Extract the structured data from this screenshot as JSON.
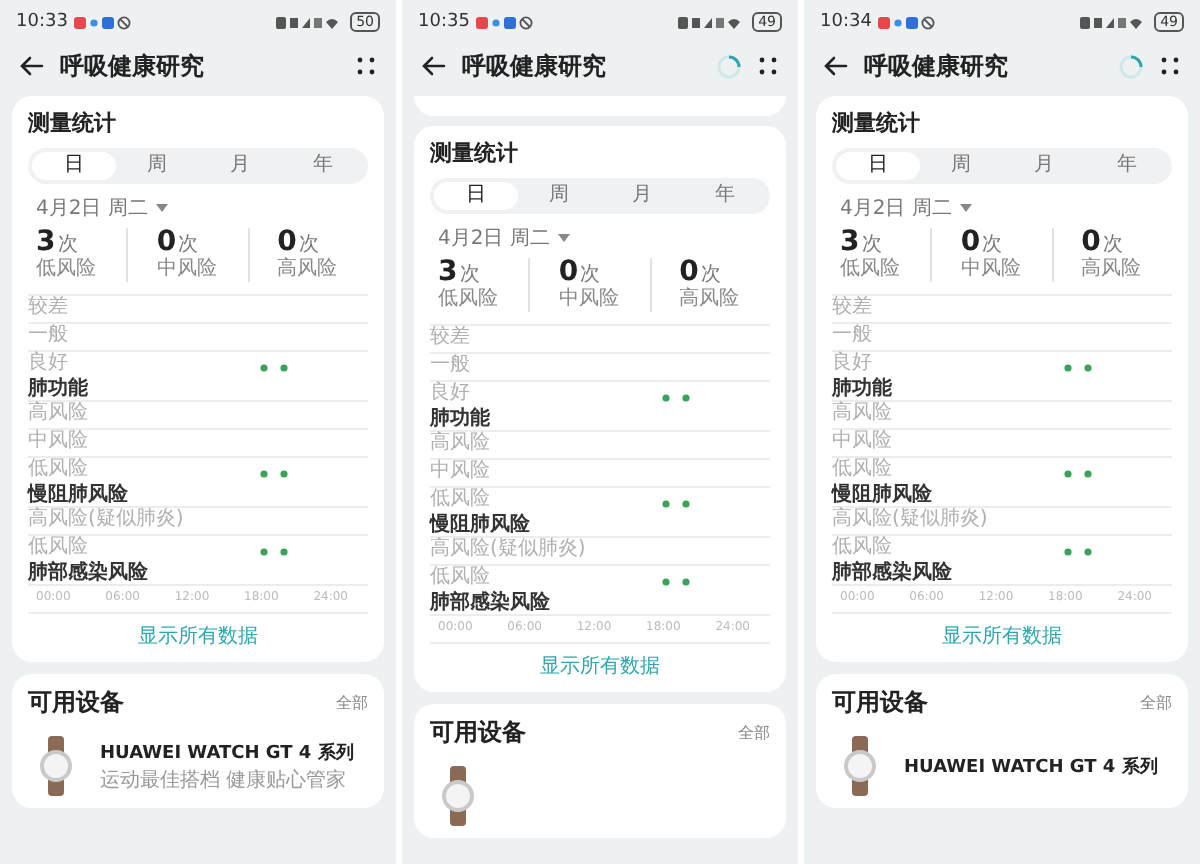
{
  "phones": [
    {
      "time": "10:33",
      "battery": "50",
      "title": "呼吸健康研究",
      "sync_ring": false,
      "previous_card": false,
      "stats_card": {
        "title": "测量统计",
        "tabs": [
          {
            "label": "日",
            "selected": true
          },
          {
            "label": "周",
            "selected": false
          },
          {
            "label": "月",
            "selected": false
          },
          {
            "label": "年",
            "selected": false
          }
        ],
        "date": "4月2日 周二",
        "stats": [
          {
            "value": "3",
            "unit": "次",
            "label": "低风险"
          },
          {
            "value": "0",
            "unit": "次",
            "label": "中风险"
          },
          {
            "value": "0",
            "unit": "次",
            "label": "高风险"
          }
        ],
        "groups": [
          {
            "category": "肺功能",
            "levels": [
              {
                "label": "较差",
                "readings": false
              },
              {
                "label": "一般",
                "readings": false
              },
              {
                "label": "良好",
                "readings": true
              }
            ]
          },
          {
            "category": "慢阻肺风险",
            "levels": [
              {
                "label": "高风险",
                "readings": false
              },
              {
                "label": "中风险",
                "readings": false
              },
              {
                "label": "低风险",
                "readings": true
              }
            ]
          },
          {
            "category": "肺部感染风险",
            "levels": [
              {
                "label": "高风险(疑似肺炎)",
                "readings": false
              },
              {
                "label": "低风险",
                "readings": true
              }
            ]
          }
        ],
        "x_ticks": [
          "00:00",
          "06:00",
          "12:00",
          "18:00",
          "24:00"
        ],
        "show_all": "显示所有数据"
      },
      "devices": {
        "title": "可用设备",
        "all_link": "全部",
        "device": {
          "name": "HUAWEI WATCH GT 4 系列",
          "subtitle": "运动最佳搭档 健康贴心管家"
        }
      }
    },
    {
      "time": "10:35",
      "battery": "49",
      "title": "呼吸健康研究",
      "sync_ring": true,
      "previous_card": true,
      "stats_card": {
        "title": "测量统计",
        "tabs": [
          {
            "label": "日",
            "selected": true
          },
          {
            "label": "周",
            "selected": false
          },
          {
            "label": "月",
            "selected": false
          },
          {
            "label": "年",
            "selected": false
          }
        ],
        "date": "4月2日 周二",
        "stats": [
          {
            "value": "3",
            "unit": "次",
            "label": "低风险"
          },
          {
            "value": "0",
            "unit": "次",
            "label": "中风险"
          },
          {
            "value": "0",
            "unit": "次",
            "label": "高风险"
          }
        ],
        "groups": [
          {
            "category": "肺功能",
            "levels": [
              {
                "label": "较差",
                "readings": false
              },
              {
                "label": "一般",
                "readings": false
              },
              {
                "label": "良好",
                "readings": true
              }
            ]
          },
          {
            "category": "慢阻肺风险",
            "levels": [
              {
                "label": "高风险",
                "readings": false
              },
              {
                "label": "中风险",
                "readings": false
              },
              {
                "label": "低风险",
                "readings": true
              }
            ]
          },
          {
            "category": "肺部感染风险",
            "levels": [
              {
                "label": "高风险(疑似肺炎)",
                "readings": false
              },
              {
                "label": "低风险",
                "readings": true
              }
            ]
          }
        ],
        "x_ticks": [
          "00:00",
          "06:00",
          "12:00",
          "18:00",
          "24:00"
        ],
        "show_all": "显示所有数据"
      },
      "devices": {
        "title": "可用设备",
        "all_link": "全部"
      }
    },
    {
      "time": "10:34",
      "battery": "49",
      "title": "呼吸健康研究",
      "sync_ring": true,
      "previous_card": false,
      "stats_card": {
        "title": "测量统计",
        "tabs": [
          {
            "label": "日",
            "selected": true
          },
          {
            "label": "周",
            "selected": false
          },
          {
            "label": "月",
            "selected": false
          },
          {
            "label": "年",
            "selected": false
          }
        ],
        "date": "4月2日 周二",
        "stats": [
          {
            "value": "3",
            "unit": "次",
            "label": "低风险"
          },
          {
            "value": "0",
            "unit": "次",
            "label": "中风险"
          },
          {
            "value": "0",
            "unit": "次",
            "label": "高风险"
          }
        ],
        "groups": [
          {
            "category": "肺功能",
            "levels": [
              {
                "label": "较差",
                "readings": false
              },
              {
                "label": "一般",
                "readings": false
              },
              {
                "label": "良好",
                "readings": true
              }
            ]
          },
          {
            "category": "慢阻肺风险",
            "levels": [
              {
                "label": "高风险",
                "readings": false
              },
              {
                "label": "中风险",
                "readings": false
              },
              {
                "label": "低风险",
                "readings": true
              }
            ]
          },
          {
            "category": "肺部感染风险",
            "levels": [
              {
                "label": "高风险(疑似肺炎)",
                "readings": false
              },
              {
                "label": "低风险",
                "readings": true
              }
            ]
          }
        ],
        "x_ticks": [
          "00:00",
          "06:00",
          "12:00",
          "18:00",
          "24:00"
        ],
        "show_all": "显示所有数据"
      },
      "devices": {
        "title": "可用设备",
        "all_link": "全部",
        "device": {
          "name": "HUAWEI WATCH GT 4 系列"
        }
      }
    }
  ]
}
